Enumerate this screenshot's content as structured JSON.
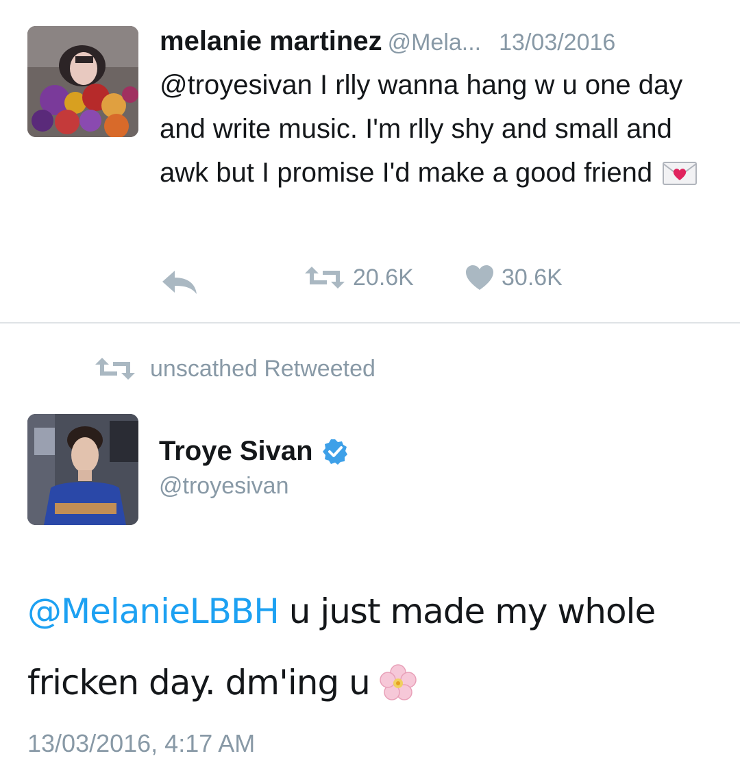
{
  "tweet1": {
    "display_name": "melanie martinez",
    "handle": "@Mela...",
    "date": "13/03/2016",
    "text": "@troyesivan I rlly wanna hang w u one day and write music. I'm rlly shy and small and awk but I promise I'd make a good friend",
    "emoji": "love-letter-emoji",
    "retweet_count": "20.6K",
    "like_count": "30.6K"
  },
  "retweet_context": {
    "label": "unscathed Retweeted"
  },
  "tweet2": {
    "display_name": "Troye Sivan",
    "handle": "@troyesivan",
    "mention": "@MelanieLBBH",
    "text": " u just made my whole fricken day. dm'ing u",
    "emoji": "cherry-blossom-emoji",
    "timestamp": "13/03/2016, 4:17 AM"
  },
  "colors": {
    "link_blue": "#1da1f2",
    "muted_gray": "#8899a6",
    "text_dark": "#14171a",
    "heart_red": "#e0245e"
  }
}
